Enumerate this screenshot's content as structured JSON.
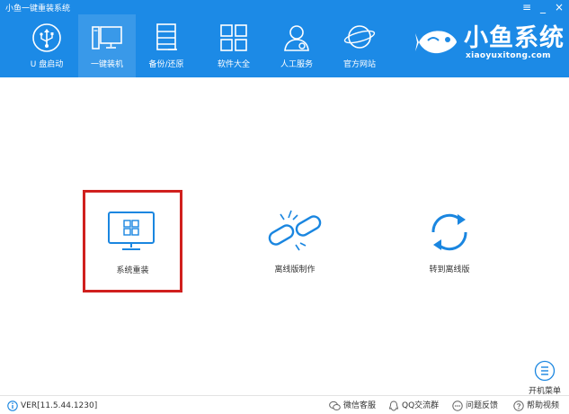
{
  "app": {
    "title": "小鱼一键重装系统"
  },
  "window_controls": {
    "menu": "≡",
    "minimize": "_",
    "close": "×"
  },
  "nav": [
    {
      "label": "U 盘启动",
      "icon": "usb-icon"
    },
    {
      "label": "一键装机",
      "icon": "computer-icon",
      "active": true
    },
    {
      "label": "备份/还原",
      "icon": "document-icon"
    },
    {
      "label": "软件大全",
      "icon": "grid-icon"
    },
    {
      "label": "人工服务",
      "icon": "person-icon"
    },
    {
      "label": "官方网站",
      "icon": "globe-icon"
    }
  ],
  "brand": {
    "name": "小鱼系统",
    "domain": "xiaoyuxitong.com",
    "icon": "fish-logo-icon"
  },
  "options": [
    {
      "label": "系统重装",
      "icon": "windows-monitor-icon",
      "highlighted": true
    },
    {
      "label": "离线版制作",
      "icon": "broken-link-icon"
    },
    {
      "label": "转到离线版",
      "icon": "refresh-icon"
    }
  ],
  "menu_button": {
    "label": "开机菜单",
    "icon": "list-circle-icon"
  },
  "footer": {
    "version": "VER[11.5.44.1230]",
    "links": [
      {
        "label": "微信客服",
        "icon": "wechat-icon"
      },
      {
        "label": "QQ交流群",
        "icon": "qq-icon"
      },
      {
        "label": "问题反馈",
        "icon": "chat-icon"
      },
      {
        "label": "帮助视频",
        "icon": "help-icon"
      }
    ]
  },
  "colors": {
    "header": "#1c8ae6",
    "accent": "#1a86e0",
    "highlight_border": "#d0201e"
  }
}
